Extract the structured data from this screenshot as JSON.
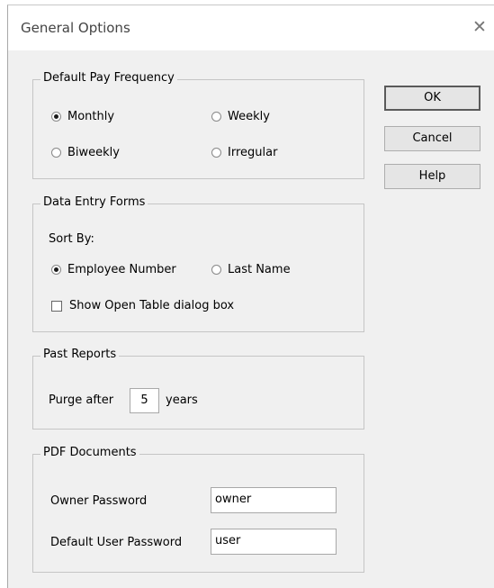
{
  "window": {
    "title": "General Options",
    "close_glyph": "✕"
  },
  "pay_frequency": {
    "legend": "Default Pay Frequency",
    "options": [
      {
        "label": "Monthly",
        "selected": true
      },
      {
        "label": "Weekly",
        "selected": false
      },
      {
        "label": "Biweekly",
        "selected": false
      },
      {
        "label": "Irregular",
        "selected": false
      }
    ]
  },
  "data_entry": {
    "legend": "Data Entry Forms",
    "sort_by_label": "Sort By:",
    "sort_options": [
      {
        "label": "Employee Number",
        "selected": true
      },
      {
        "label": "Last Name",
        "selected": false
      }
    ],
    "show_open_table_label": "Show Open Table dialog box",
    "show_open_table_checked": false
  },
  "past_reports": {
    "legend": "Past Reports",
    "purge_prefix": "Purge after",
    "purge_value": "5",
    "purge_suffix": "years"
  },
  "pdf": {
    "legend": "PDF Documents",
    "owner_label": "Owner Password",
    "owner_value": "owner",
    "user_label": "Default User Password",
    "user_value": "user"
  },
  "buttons": {
    "ok": "OK",
    "cancel": "Cancel",
    "help": "Help"
  }
}
